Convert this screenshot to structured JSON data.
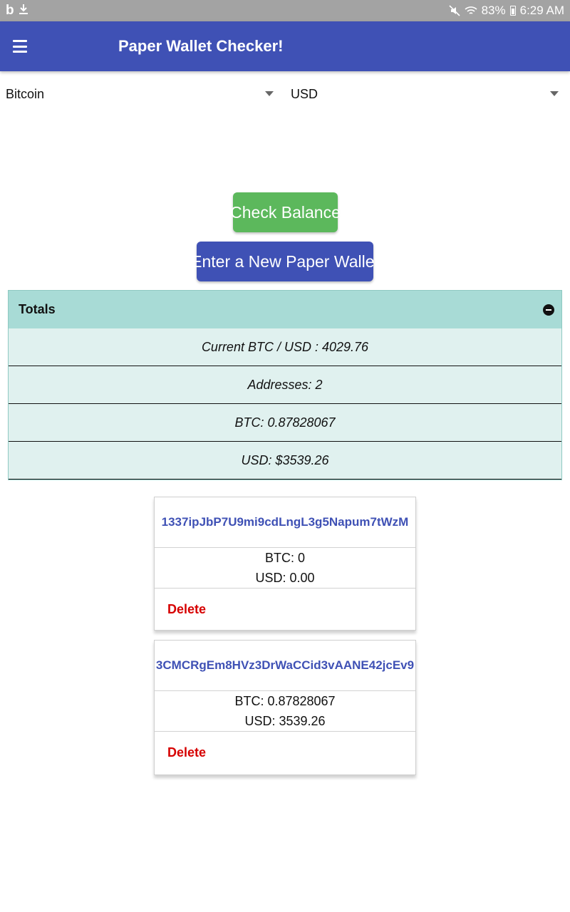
{
  "status_bar": {
    "left_icons": [
      "b-icon",
      "download-icon"
    ],
    "battery": "83%",
    "time": "6:29 AM"
  },
  "app_bar": {
    "title": "Paper Wallet Checker!"
  },
  "selectors": {
    "crypto": "Bitcoin",
    "fiat": "USD"
  },
  "buttons": {
    "check_balance": "Check Balance",
    "new_wallet": "Enter a New Paper Wallet"
  },
  "totals": {
    "title": "Totals",
    "rows": [
      "Current BTC / USD : 4029.76",
      "Addresses: 2",
      "BTC: 0.87828067",
      "USD: $3539.26"
    ]
  },
  "wallets": [
    {
      "address": "1337ipJbP7U9mi9cdLngL3g5Napum7tWzM",
      "btc": "BTC: 0",
      "usd": "USD: 0.00",
      "delete": "Delete"
    },
    {
      "address": "3CMCRgEm8HVz3DrWaCCid3vAANE42jcEv9",
      "btc": "BTC: 0.87828067",
      "usd": "USD: 3539.26",
      "delete": "Delete"
    }
  ],
  "colors": {
    "primary": "#3f51b5",
    "success": "#5cb85c",
    "danger": "#d60000",
    "totals_header": "#a8dbd6",
    "totals_row": "#e0f1ef"
  }
}
